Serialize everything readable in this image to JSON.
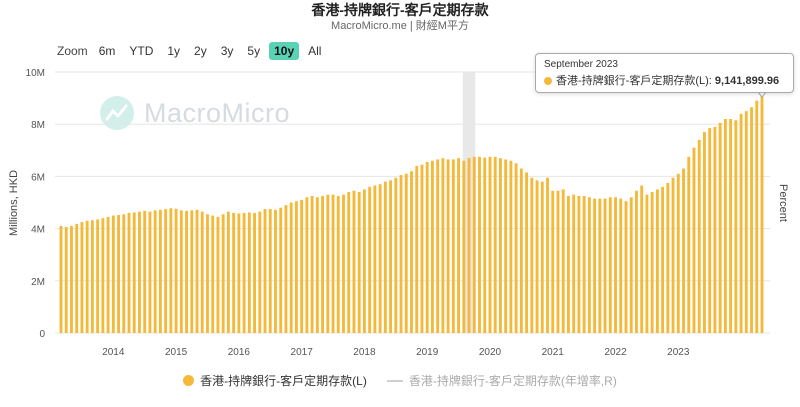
{
  "header": {
    "title": "香港-持牌銀行-客戶定期存款",
    "subtitle": "MacroMicro.me | 財經M平方"
  },
  "range_selector": {
    "zoom_label": "Zoom",
    "buttons": [
      "6m",
      "YTD",
      "1y",
      "2y",
      "3y",
      "5y",
      "10y",
      "All"
    ],
    "active": "10y"
  },
  "watermark": {
    "text": "MacroMicro"
  },
  "tooltip": {
    "date": "September 2023",
    "series": "香港-持牌銀行-客戶定期存款(L):",
    "value": "9,141,899.96"
  },
  "legend": {
    "primary": "香港-持牌銀行-客戶定期存款(L)",
    "secondary": "香港-持牌銀行-客戶定期存款(年增率,R)"
  },
  "colors": {
    "bar": "#f5b93a",
    "accent": "#5ad3b4",
    "grid": "#e6e6e6",
    "highlight": "#e8e8e8"
  },
  "chart_data": {
    "type": "bar",
    "title": "香港-持牌銀行-客戶定期存款",
    "ylabel_left": "Millions, HKD",
    "ylabel_right": "Percent",
    "y_ticks": [
      "0",
      "2M",
      "4M",
      "6M",
      "8M",
      "10M"
    ],
    "y_tick_values": [
      0,
      2000000,
      4000000,
      6000000,
      8000000,
      10000000
    ],
    "ylim": [
      0,
      10000000
    ],
    "x_ticks": [
      "2014",
      "2015",
      "2016",
      "2017",
      "2018",
      "2019",
      "2020",
      "2021",
      "2022",
      "2023"
    ],
    "start": "2013-09",
    "end": "2023-09",
    "highlight_month": "2020-03",
    "series": [
      {
        "name": "香港-持牌銀行-客戶定期存款(L)",
        "values": [
          4100000,
          4060000,
          4100000,
          4180000,
          4250000,
          4300000,
          4320000,
          4350000,
          4400000,
          4450000,
          4500000,
          4520000,
          4550000,
          4600000,
          4620000,
          4650000,
          4680000,
          4650000,
          4700000,
          4720000,
          4750000,
          4780000,
          4760000,
          4700000,
          4680000,
          4700000,
          4720000,
          4650000,
          4550000,
          4500000,
          4450000,
          4550000,
          4650000,
          4600000,
          4580000,
          4600000,
          4620000,
          4600000,
          4650000,
          4750000,
          4750000,
          4720000,
          4800000,
          4900000,
          5000000,
          5050000,
          5100000,
          5200000,
          5250000,
          5200000,
          5250000,
          5300000,
          5300000,
          5250000,
          5300000,
          5400000,
          5450000,
          5400000,
          5500000,
          5600000,
          5650000,
          5700000,
          5800000,
          5850000,
          5950000,
          6050000,
          6100000,
          6200000,
          6400000,
          6450000,
          6550000,
          6600000,
          6650000,
          6700000,
          6650000,
          6650000,
          6700000,
          6600000,
          6700000,
          6750000,
          6750000,
          6720000,
          6750000,
          6750000,
          6700000,
          6650000,
          6600000,
          6500000,
          6300000,
          6150000,
          5950000,
          5850000,
          5800000,
          5950000,
          5450000,
          5450000,
          5500000,
          5250000,
          5300000,
          5250000,
          5250000,
          5200000,
          5150000,
          5150000,
          5150000,
          5200000,
          5200000,
          5150000,
          5050000,
          5200000,
          5450000,
          5650000,
          5300000,
          5400000,
          5500000,
          5600000,
          5750000,
          5950000,
          6100000,
          6300000,
          6750000,
          7100000,
          7400000,
          7700000,
          7850000,
          7900000,
          8050000,
          8200000,
          8200000,
          8150000,
          8400000,
          8500000,
          8650000,
          8900000,
          9141899.96
        ]
      }
    ]
  }
}
